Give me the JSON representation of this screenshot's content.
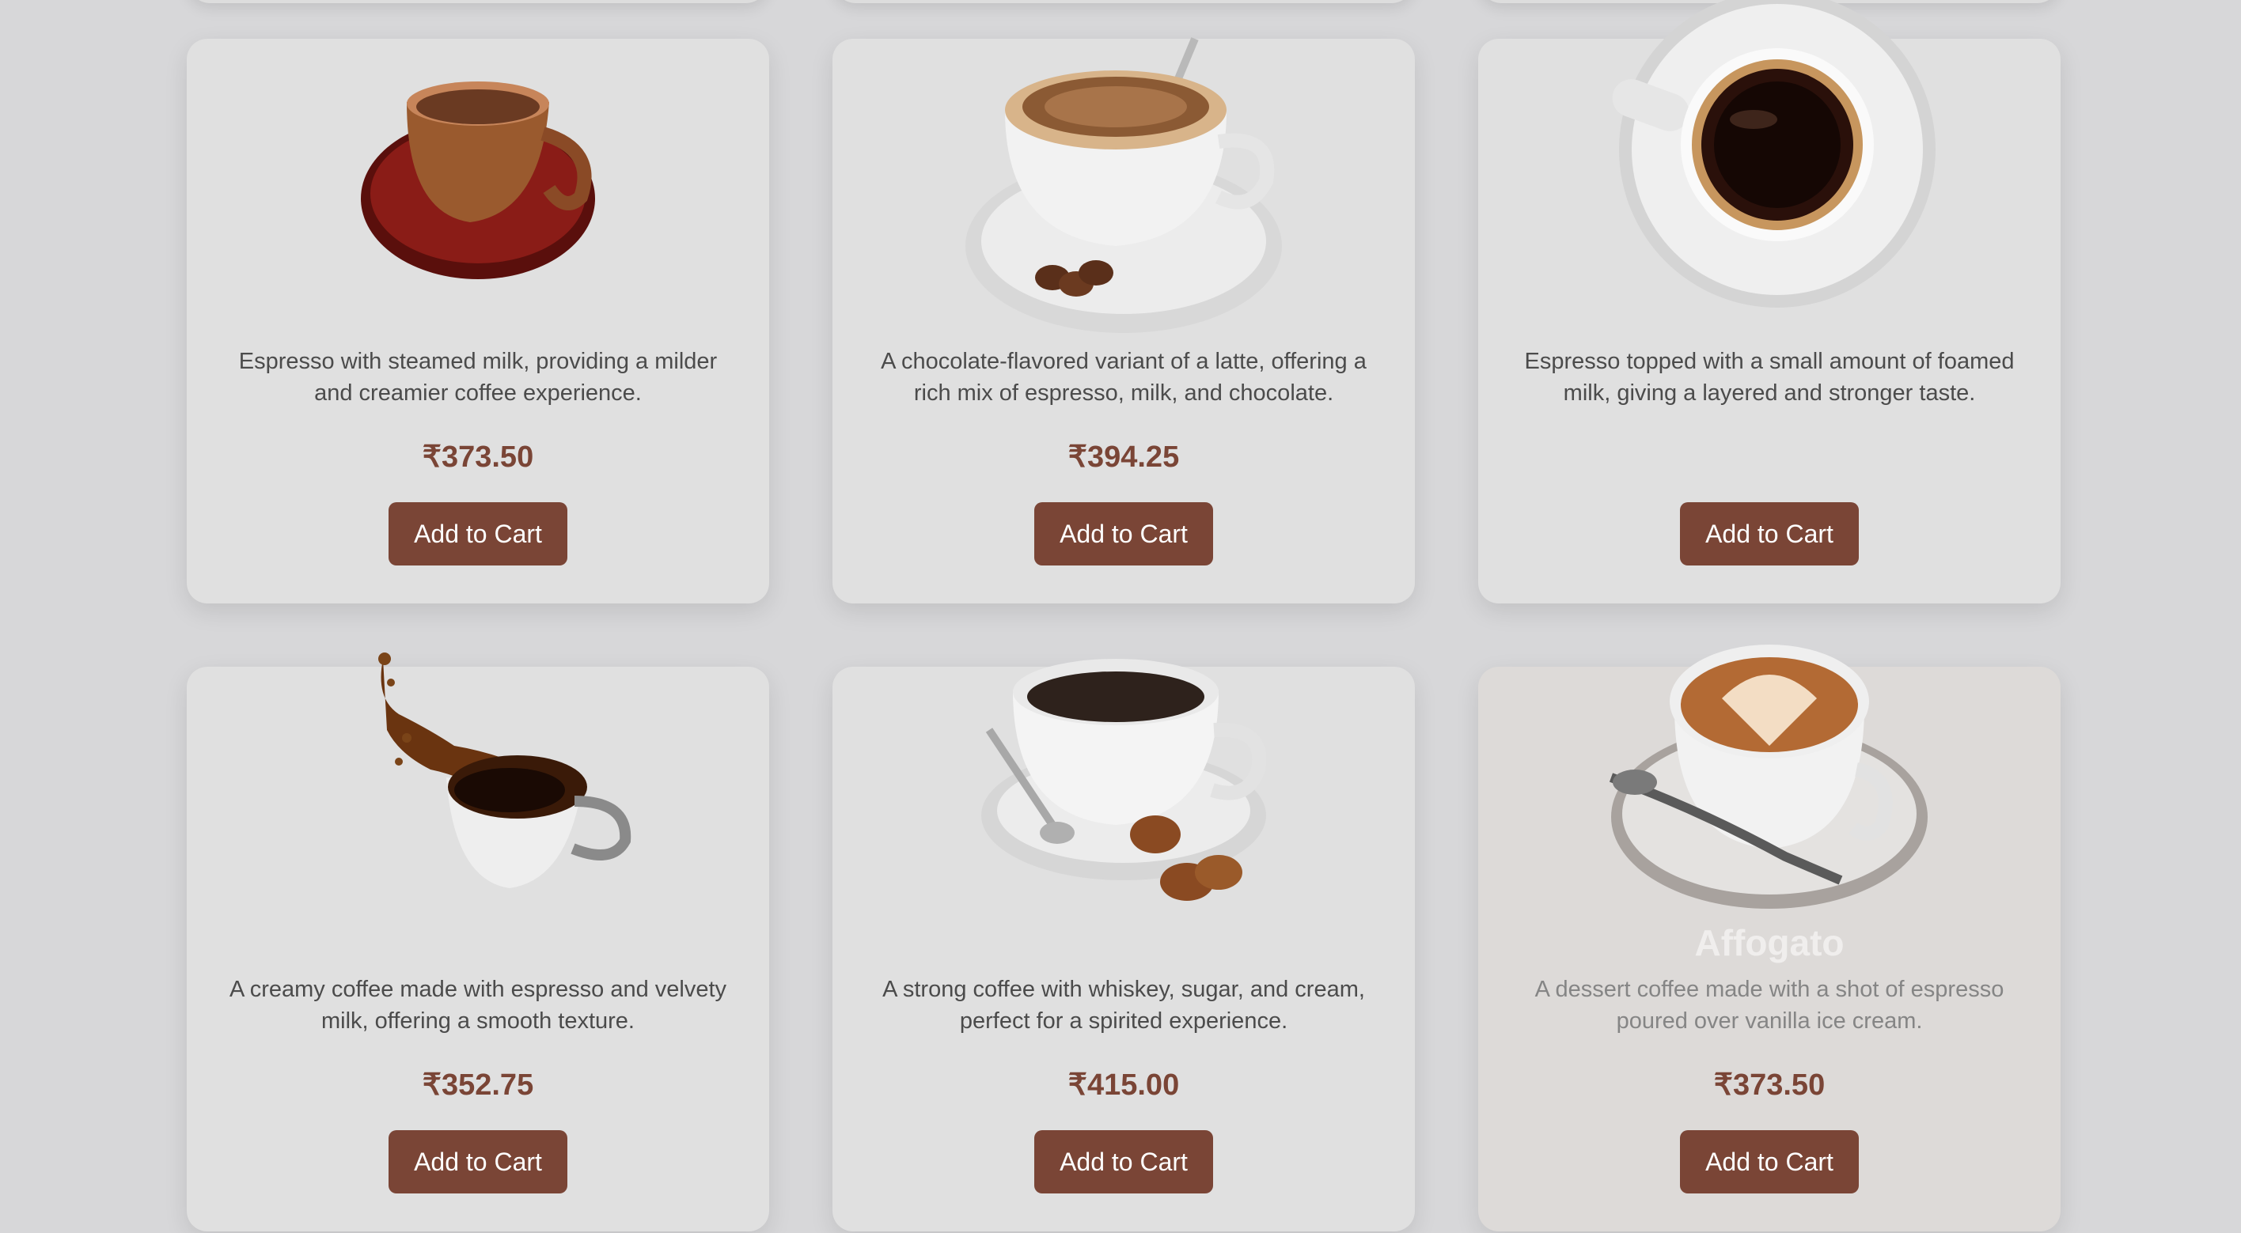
{
  "products": [
    {
      "name": "",
      "description": "Espresso with steamed milk, providing a milder and creamier coffee experience.",
      "price": "₹373.50",
      "button_label": "Add to Cart",
      "image": "latte-cup-image"
    },
    {
      "name": "",
      "description": "A chocolate-flavored variant of a latte, offering a rich mix of espresso, milk, and chocolate.",
      "price": "₹394.25",
      "button_label": "Add to Cart",
      "image": "mocha-cup-image"
    },
    {
      "name": "",
      "description": "Espresso topped with a small amount of foamed milk, giving a layered and stronger taste.",
      "price": "",
      "button_label": "Add to Cart",
      "image": "macchiato-cup-image"
    },
    {
      "name": "",
      "description": "A creamy coffee made with espresso and velvety milk, offering a smooth texture.",
      "price": "₹352.75",
      "button_label": "Add to Cart",
      "image": "flat-white-splash-image"
    },
    {
      "name": "",
      "description": "A strong coffee with whiskey, sugar, and cream, perfect for a spirited experience.",
      "price": "₹415.00",
      "button_label": "Add to Cart",
      "image": "irish-coffee-cup-image"
    },
    {
      "name": "Affogato",
      "description": "A dessert coffee made with a shot of espresso poured over vanilla ice cream.",
      "price": "₹373.50",
      "button_label": "Add to Cart",
      "image": "affogato-cup-image"
    }
  ],
  "colors": {
    "accent": "#7a4536",
    "card": "#e0e0e0",
    "background": "#d7d7d9"
  }
}
